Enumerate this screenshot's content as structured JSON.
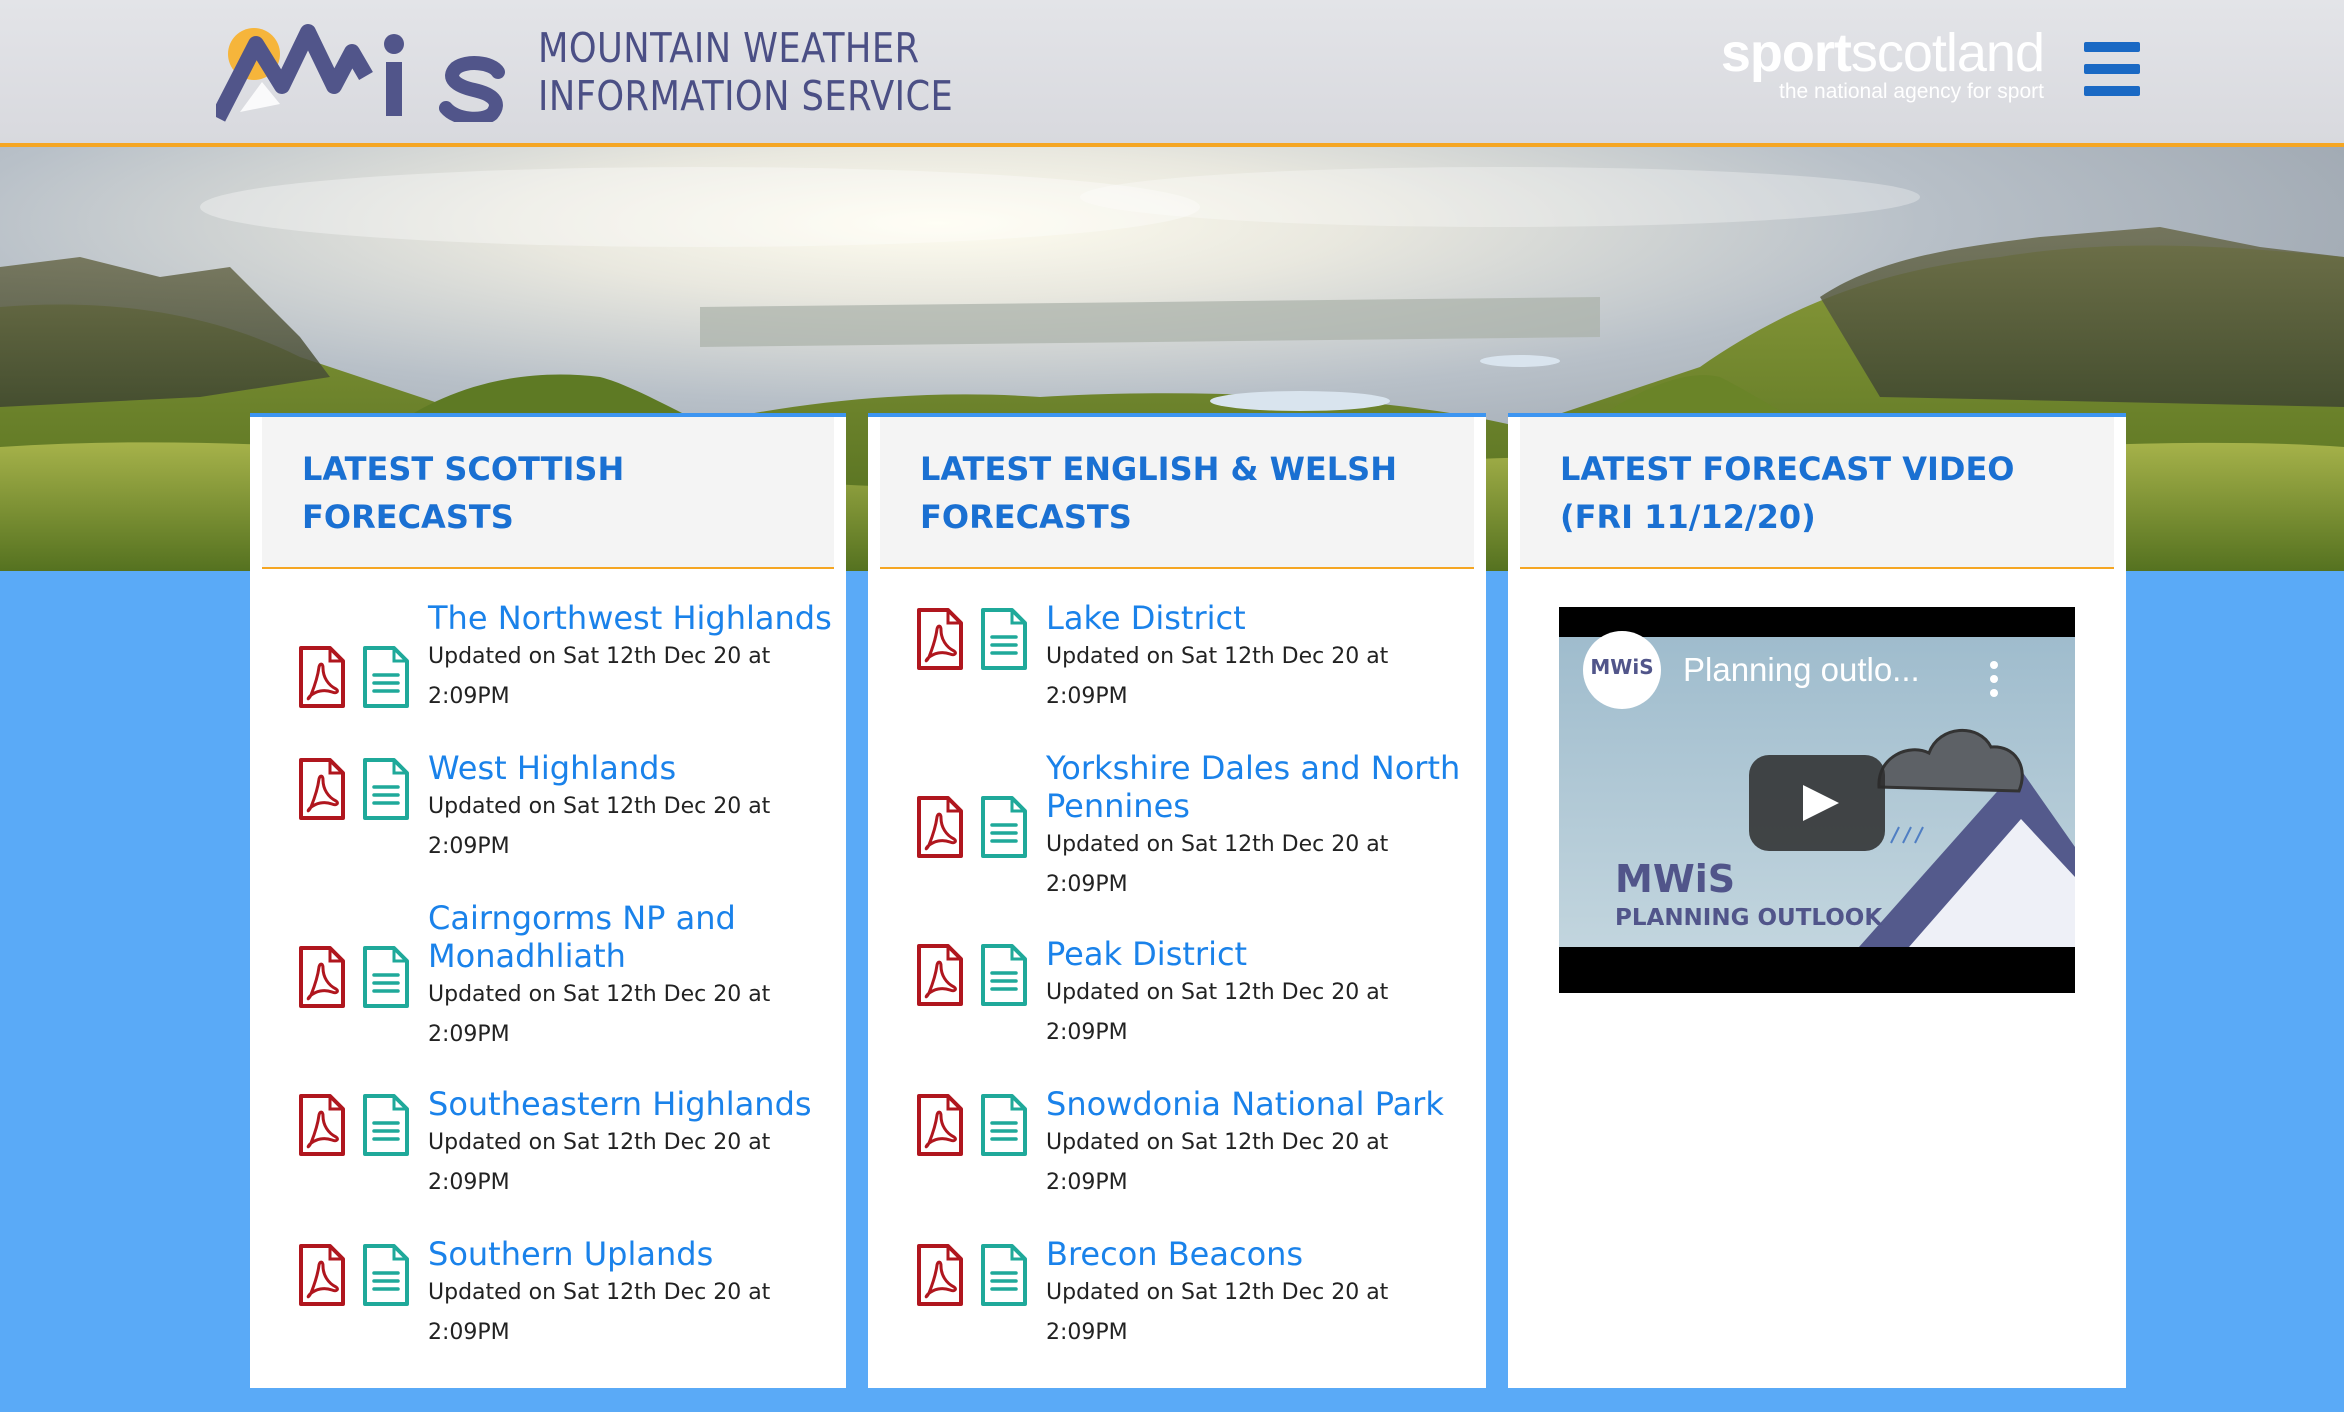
{
  "header": {
    "brand_line_1": "MOUNTAIN WEATHER",
    "brand_line_2": "INFORMATION SERVICE",
    "sponsor_name_bold": "sport",
    "sponsor_name_regular": "scotland",
    "sponsor_tagline": "the national agency for sport",
    "menu_icon": "hamburger-icon"
  },
  "scottish": {
    "title": "LATEST SCOTTISH FORECASTS",
    "items": [
      {
        "name": "The Northwest Highlands",
        "updated": "Updated on Sat 12th Dec 20 at 2:09PM"
      },
      {
        "name": "West Highlands",
        "updated": "Updated on Sat 12th Dec 20 at 2:09PM"
      },
      {
        "name": "Cairngorms NP and Monadhliath",
        "updated": "Updated on Sat 12th Dec 20 at 2:09PM"
      },
      {
        "name": "Southeastern Highlands",
        "updated": "Updated on Sat 12th Dec 20 at 2:09PM"
      },
      {
        "name": "Southern Uplands",
        "updated": "Updated on Sat 12th Dec 20 at 2:09PM"
      }
    ]
  },
  "english": {
    "title": "LATEST ENGLISH & WELSH FORECASTS",
    "items": [
      {
        "name": "Lake District",
        "updated": "Updated on Sat 12th Dec 20 at 2:09PM"
      },
      {
        "name": "Yorkshire Dales and North Pennines",
        "updated": "Updated on Sat 12th Dec 20 at 2:09PM"
      },
      {
        "name": "Peak District",
        "updated": "Updated on Sat 12th Dec 20 at 2:09PM"
      },
      {
        "name": "Snowdonia National Park",
        "updated": "Updated on Sat 12th Dec 20 at 2:09PM"
      },
      {
        "name": "Brecon Beacons",
        "updated": "Updated on Sat 12th Dec 20 at 2:09PM"
      }
    ]
  },
  "video": {
    "title": "LATEST FORECAST VIDEO (FRI 11/12/20)",
    "video_title": "Planning outlo...",
    "channel_badge": "MWiS",
    "thumb_brand": "MWiS",
    "thumb_caption": "PLANNING OUTLOOK"
  },
  "colors": {
    "page_bg": "#5aaaf7",
    "accent": "#f5a623",
    "link": "#1a82ea",
    "heading": "#1a70d2",
    "pdf_icon": "#b0161e",
    "doc_icon": "#1fa99a"
  }
}
